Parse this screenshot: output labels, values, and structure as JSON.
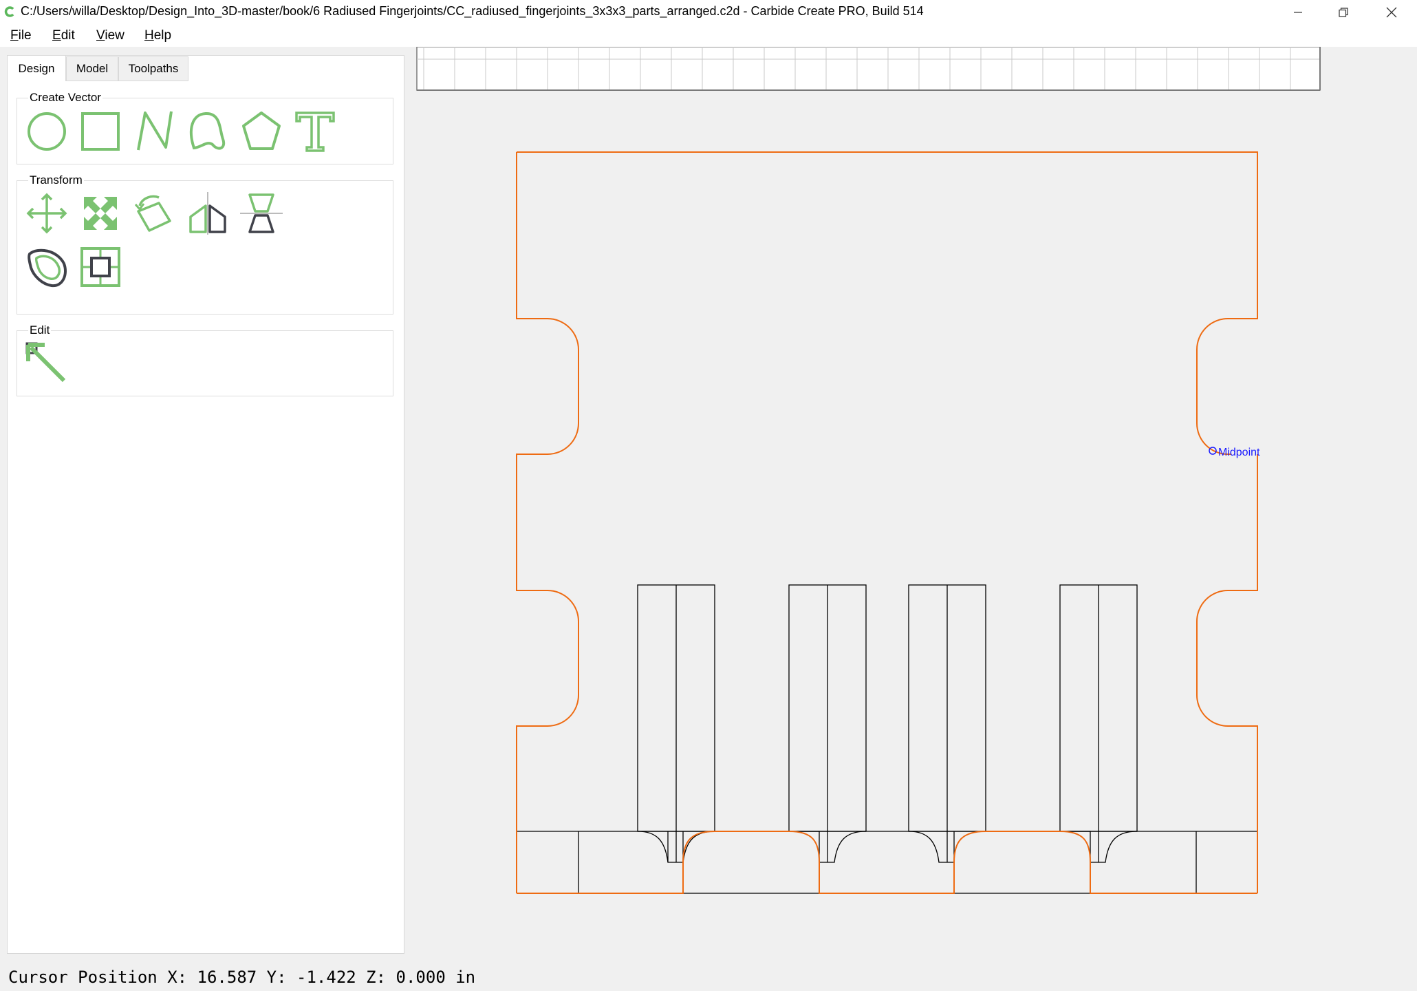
{
  "window": {
    "title": "C:/Users/willa/Desktop/Design_Into_3D-master/book/6 Radiused Fingerjoints/CC_radiused_fingerjoints_3x3x3_parts_arranged.c2d - Carbide Create PRO, Build 514"
  },
  "menu": {
    "items": [
      {
        "label": "File",
        "accel": "F",
        "rest": "ile"
      },
      {
        "label": "Edit",
        "accel": "E",
        "rest": "dit"
      },
      {
        "label": "View",
        "accel": "V",
        "rest": "iew"
      },
      {
        "label": "Help",
        "accel": "H",
        "rest": "elp"
      }
    ]
  },
  "tabs": [
    {
      "label": "Design",
      "active": true
    },
    {
      "label": "Model",
      "active": false
    },
    {
      "label": "Toolpaths",
      "active": false
    }
  ],
  "groups": {
    "create_vector": {
      "title": "Create Vector",
      "tools": [
        "circle-icon",
        "rectangle-icon",
        "polyline-icon",
        "curve-icon",
        "polygon-icon",
        "text-icon"
      ]
    },
    "transform": {
      "title": "Transform",
      "tools": [
        "move-icon",
        "scale-icon",
        "rotate-icon",
        "mirror-icon",
        "align-icon",
        "offset-icon",
        "center-icon"
      ]
    },
    "edit": {
      "title": "Edit",
      "tools": [
        "edit-nodes-icon"
      ]
    }
  },
  "canvas": {
    "snap_label": "Midpoint",
    "colors": {
      "selected": "#ee6b12",
      "unselected": "#000000",
      "snap": "#1a1aff",
      "tool_green": "#7bc271",
      "tool_dark": "#40424a"
    }
  },
  "status": {
    "text": "Cursor Position X: 16.587 Y: -1.422 Z: 0.000 in"
  }
}
